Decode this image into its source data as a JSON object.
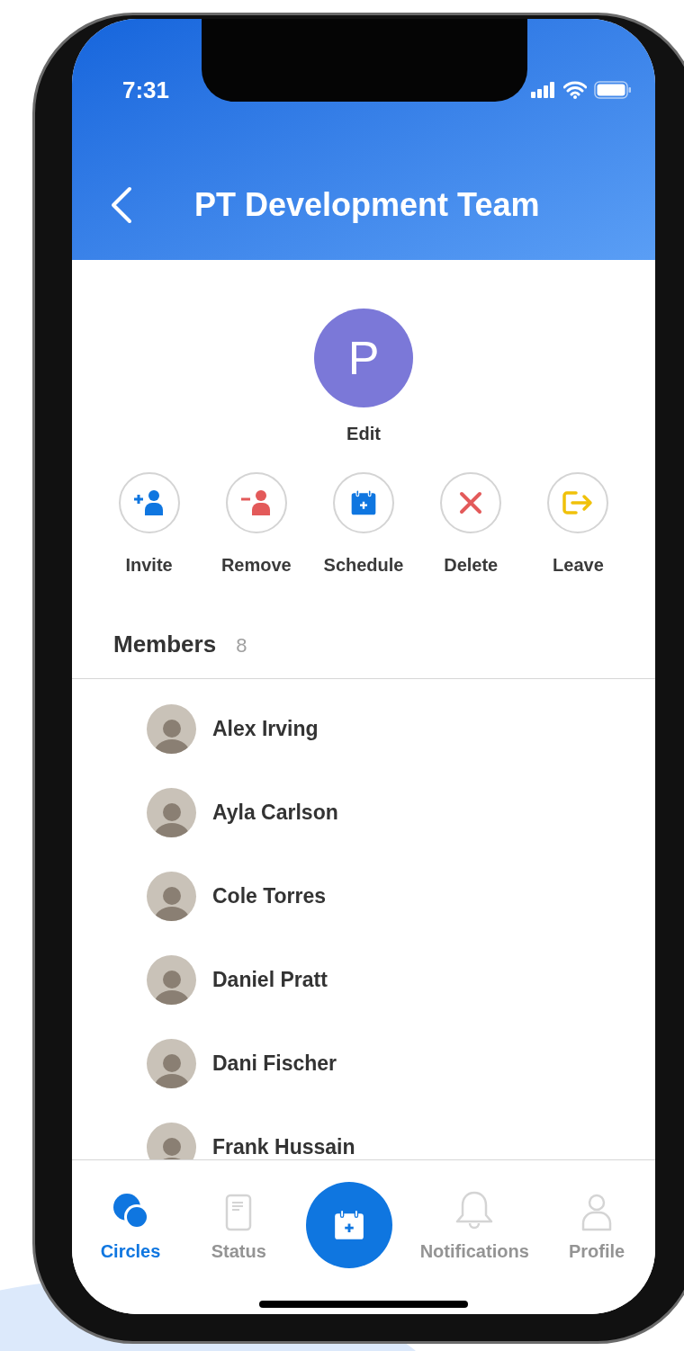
{
  "status_bar": {
    "time": "7:31"
  },
  "header": {
    "title": "PT Development Team"
  },
  "group": {
    "initial": "P",
    "edit_label": "Edit"
  },
  "actions": [
    {
      "kind": "invite",
      "label": "Invite"
    },
    {
      "kind": "remove",
      "label": "Remove"
    },
    {
      "kind": "schedule",
      "label": "Schedule"
    },
    {
      "kind": "delete",
      "label": "Delete"
    },
    {
      "kind": "leave",
      "label": "Leave"
    }
  ],
  "members": {
    "title": "Members",
    "count": "8",
    "items": [
      {
        "name": "Alex Irving"
      },
      {
        "name": "Ayla Carlson"
      },
      {
        "name": "Cole Torres"
      },
      {
        "name": "Daniel Pratt"
      },
      {
        "name": "Dani Fischer"
      },
      {
        "name": "Frank Hussain"
      }
    ]
  },
  "tab_bar": [
    {
      "kind": "circles",
      "label": "Circles",
      "selected": true
    },
    {
      "kind": "status",
      "label": "Status",
      "selected": false
    },
    {
      "kind": "add",
      "selected": false
    },
    {
      "kind": "notifications",
      "label": "Notifications",
      "selected": false
    },
    {
      "kind": "profile",
      "label": "Profile",
      "selected": false
    }
  ]
}
